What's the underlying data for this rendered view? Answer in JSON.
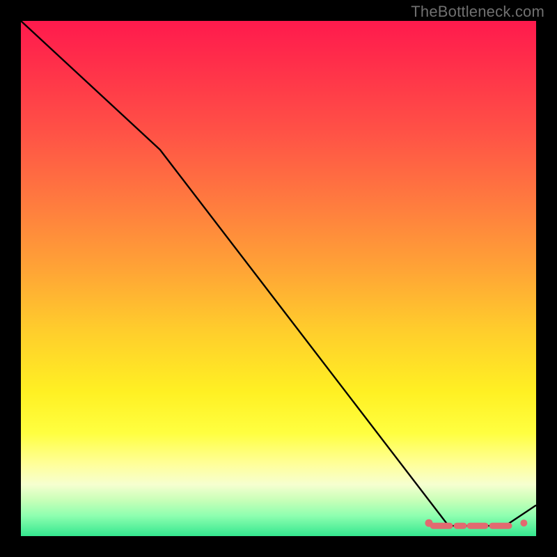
{
  "watermark": "TheBottleneck.com",
  "chart_data": {
    "type": "line",
    "title": "",
    "xlabel": "",
    "ylabel": "",
    "xlim": [
      0,
      100
    ],
    "ylim": [
      0,
      100
    ],
    "grid": false,
    "legend": false,
    "x": [
      0,
      27,
      83,
      94,
      100
    ],
    "values": [
      100,
      75,
      2,
      2,
      6
    ],
    "annotations": [],
    "highlight_region": {
      "x_start": 80,
      "x_end": 96,
      "y": 2
    }
  },
  "colors": {
    "gradient_top": "#ff1a4d",
    "gradient_mid": "#ffe623",
    "gradient_bottom": "#34e78f",
    "curve": "#000000",
    "dots": "#e26a70",
    "frame": "#000000"
  }
}
